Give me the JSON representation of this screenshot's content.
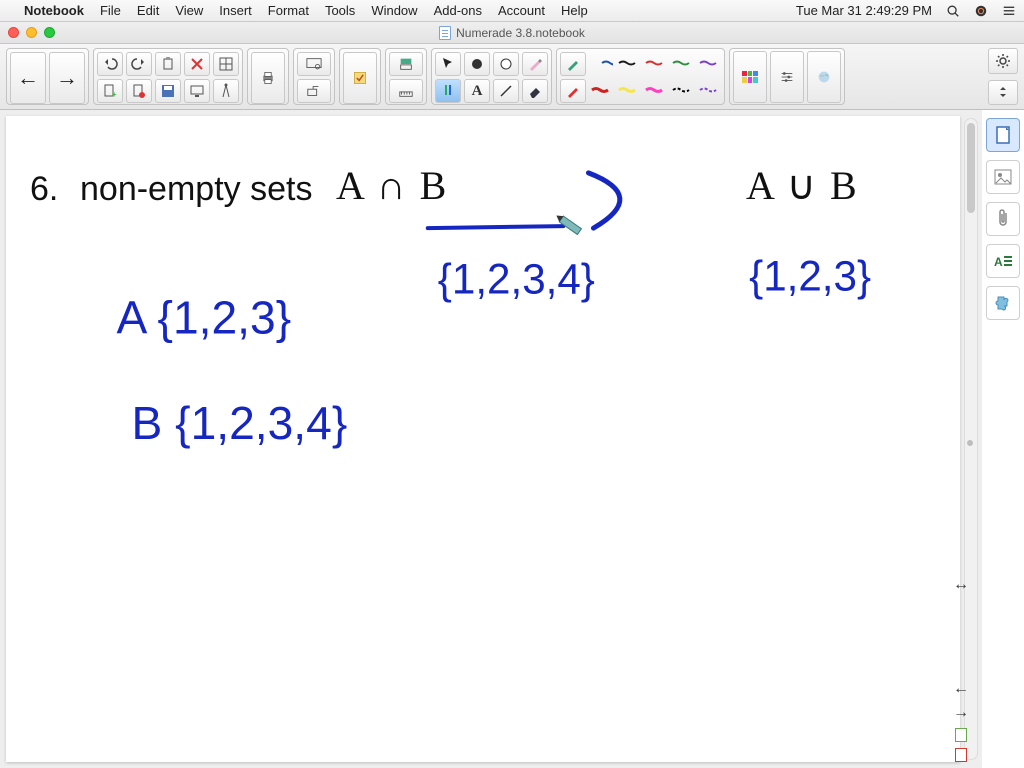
{
  "mac_menu": {
    "app": "Notebook",
    "items": [
      "File",
      "Edit",
      "View",
      "Insert",
      "Format",
      "Tools",
      "Window",
      "Add-ons",
      "Account",
      "Help"
    ],
    "clock": "Tue Mar 31  2:49:29 PM"
  },
  "window": {
    "title": "Numerade 3.8.notebook"
  },
  "toolbar": {
    "nav_prev": "←",
    "nav_next": "→",
    "penColors": {
      "top": [
        "#1f4fb5",
        "#1a1a1a",
        "#d62f2f",
        "#2f8f3a",
        "#7a3fcf"
      ],
      "bottom": [
        "#c22",
        "#f5e64a",
        "#ff3fc0",
        "#000",
        "#7a3fcf"
      ]
    }
  },
  "right_panel": {
    "items": [
      "page-icon",
      "image-icon",
      "attachment-icon",
      "text-style-icon",
      "addon-icon"
    ],
    "resize": "↔"
  },
  "canvas": {
    "question_number": "6.",
    "question_text": "non-empty sets",
    "expr_intersection": "A ∩ B",
    "expr_union": "A ∪ B",
    "hand_A": "A {1,2,3}",
    "hand_B": "B {1,2,3,4}",
    "hand_mid": "{1,2,3,4}",
    "hand_right": "{1,2,3}"
  }
}
